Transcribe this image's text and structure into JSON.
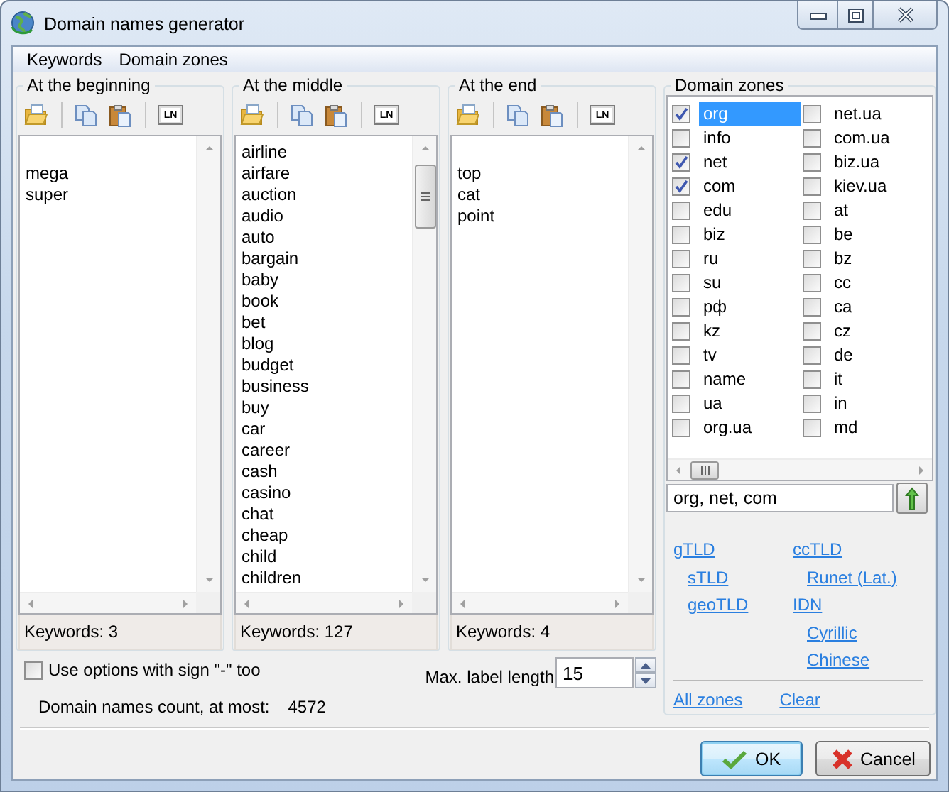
{
  "window": {
    "title": "Domain names generator"
  },
  "menu": [
    {
      "label": "Keywords"
    },
    {
      "label": "Domain zones"
    }
  ],
  "keyword_groups": [
    {
      "title": "At the beginning",
      "tools": [
        {
          "kind": "open"
        },
        {
          "kind": "separator"
        },
        {
          "kind": "copy"
        },
        {
          "kind": "paste"
        },
        {
          "kind": "separator"
        },
        {
          "kind": "numbering",
          "label": "LN"
        }
      ],
      "leading_blank": true,
      "scrollable": false,
      "keywords": [
        "mega",
        "super"
      ],
      "count": "Keywords: 3"
    },
    {
      "title": "At the middle",
      "tools": [
        {
          "kind": "open"
        },
        {
          "kind": "separator"
        },
        {
          "kind": "copy"
        },
        {
          "kind": "paste"
        },
        {
          "kind": "separator"
        },
        {
          "kind": "numbering",
          "label": "LN"
        }
      ],
      "leading_blank": false,
      "scrollable": true,
      "keywords": [
        "airline",
        "airfare",
        "auction",
        "audio",
        "auto",
        "bargain",
        "baby",
        "book",
        "bet",
        "blog",
        "budget",
        "business",
        "buy",
        "car",
        "career",
        "cash",
        "casino",
        "chat",
        "cheap",
        "child",
        "children"
      ],
      "count": "Keywords: 127"
    },
    {
      "title": "At the end",
      "tools": [
        {
          "kind": "open"
        },
        {
          "kind": "separator"
        },
        {
          "kind": "copy"
        },
        {
          "kind": "paste"
        },
        {
          "kind": "separator"
        },
        {
          "kind": "numbering",
          "label": "LN"
        }
      ],
      "leading_blank": true,
      "scrollable": false,
      "keywords": [
        "top",
        "cat",
        "point"
      ],
      "count": "Keywords: 4"
    }
  ],
  "domain_zones": {
    "title": "Domain zones",
    "columns": [
      [
        {
          "label": "org",
          "checked": true,
          "selected": true
        },
        {
          "label": "info",
          "checked": false,
          "selected": false
        },
        {
          "label": "net",
          "checked": true,
          "selected": false
        },
        {
          "label": "com",
          "checked": true,
          "selected": false
        },
        {
          "label": "edu",
          "checked": false,
          "selected": false
        },
        {
          "label": "biz",
          "checked": false,
          "selected": false
        },
        {
          "label": "ru",
          "checked": false,
          "selected": false
        },
        {
          "label": "su",
          "checked": false,
          "selected": false
        },
        {
          "label": "рф",
          "checked": false,
          "selected": false
        },
        {
          "label": "kz",
          "checked": false,
          "selected": false
        },
        {
          "label": "tv",
          "checked": false,
          "selected": false
        },
        {
          "label": "name",
          "checked": false,
          "selected": false
        },
        {
          "label": "ua",
          "checked": false,
          "selected": false
        },
        {
          "label": "org.ua",
          "checked": false,
          "selected": false
        }
      ],
      [
        {
          "label": "net.ua",
          "checked": false,
          "selected": false
        },
        {
          "label": "com.ua",
          "checked": false,
          "selected": false
        },
        {
          "label": "biz.ua",
          "checked": false,
          "selected": false
        },
        {
          "label": "kiev.ua",
          "checked": false,
          "selected": false
        },
        {
          "label": "at",
          "checked": false,
          "selected": false
        },
        {
          "label": "be",
          "checked": false,
          "selected": false
        },
        {
          "label": "bz",
          "checked": false,
          "selected": false
        },
        {
          "label": "cc",
          "checked": false,
          "selected": false
        },
        {
          "label": "ca",
          "checked": false,
          "selected": false
        },
        {
          "label": "cz",
          "checked": false,
          "selected": false
        },
        {
          "label": "de",
          "checked": false,
          "selected": false
        },
        {
          "label": "it",
          "checked": false,
          "selected": false
        },
        {
          "label": "in",
          "checked": false,
          "selected": false
        },
        {
          "label": "md",
          "checked": false,
          "selected": false
        }
      ]
    ],
    "field": {
      "value": "org, net, com"
    },
    "link_columns": [
      [
        {
          "label": "gTLD",
          "children": [
            {
              "label": "sTLD"
            },
            {
              "label": "geoTLD"
            }
          ]
        }
      ],
      [
        {
          "label": "ccTLD",
          "children": [
            {
              "label": "Runet (Lat.)"
            }
          ]
        },
        {
          "label": "IDN",
          "children": [
            {
              "label": "Cyrillic"
            },
            {
              "label": "Chinese"
            }
          ]
        }
      ]
    ],
    "actions": [
      {
        "label": "All zones"
      },
      {
        "label": "Clear"
      }
    ]
  },
  "options": {
    "minus_sign": {
      "label": "Use options with sign \"-\" too",
      "checked": false
    },
    "count_label": "Domain names count, at most:",
    "count_value": "4572",
    "max_label": {
      "label": "Max. label length",
      "value": "15"
    }
  },
  "buttons": [
    {
      "label": "OK",
      "kind": "ok",
      "default": true
    },
    {
      "label": "Cancel",
      "kind": "cancel",
      "default": false
    }
  ]
}
